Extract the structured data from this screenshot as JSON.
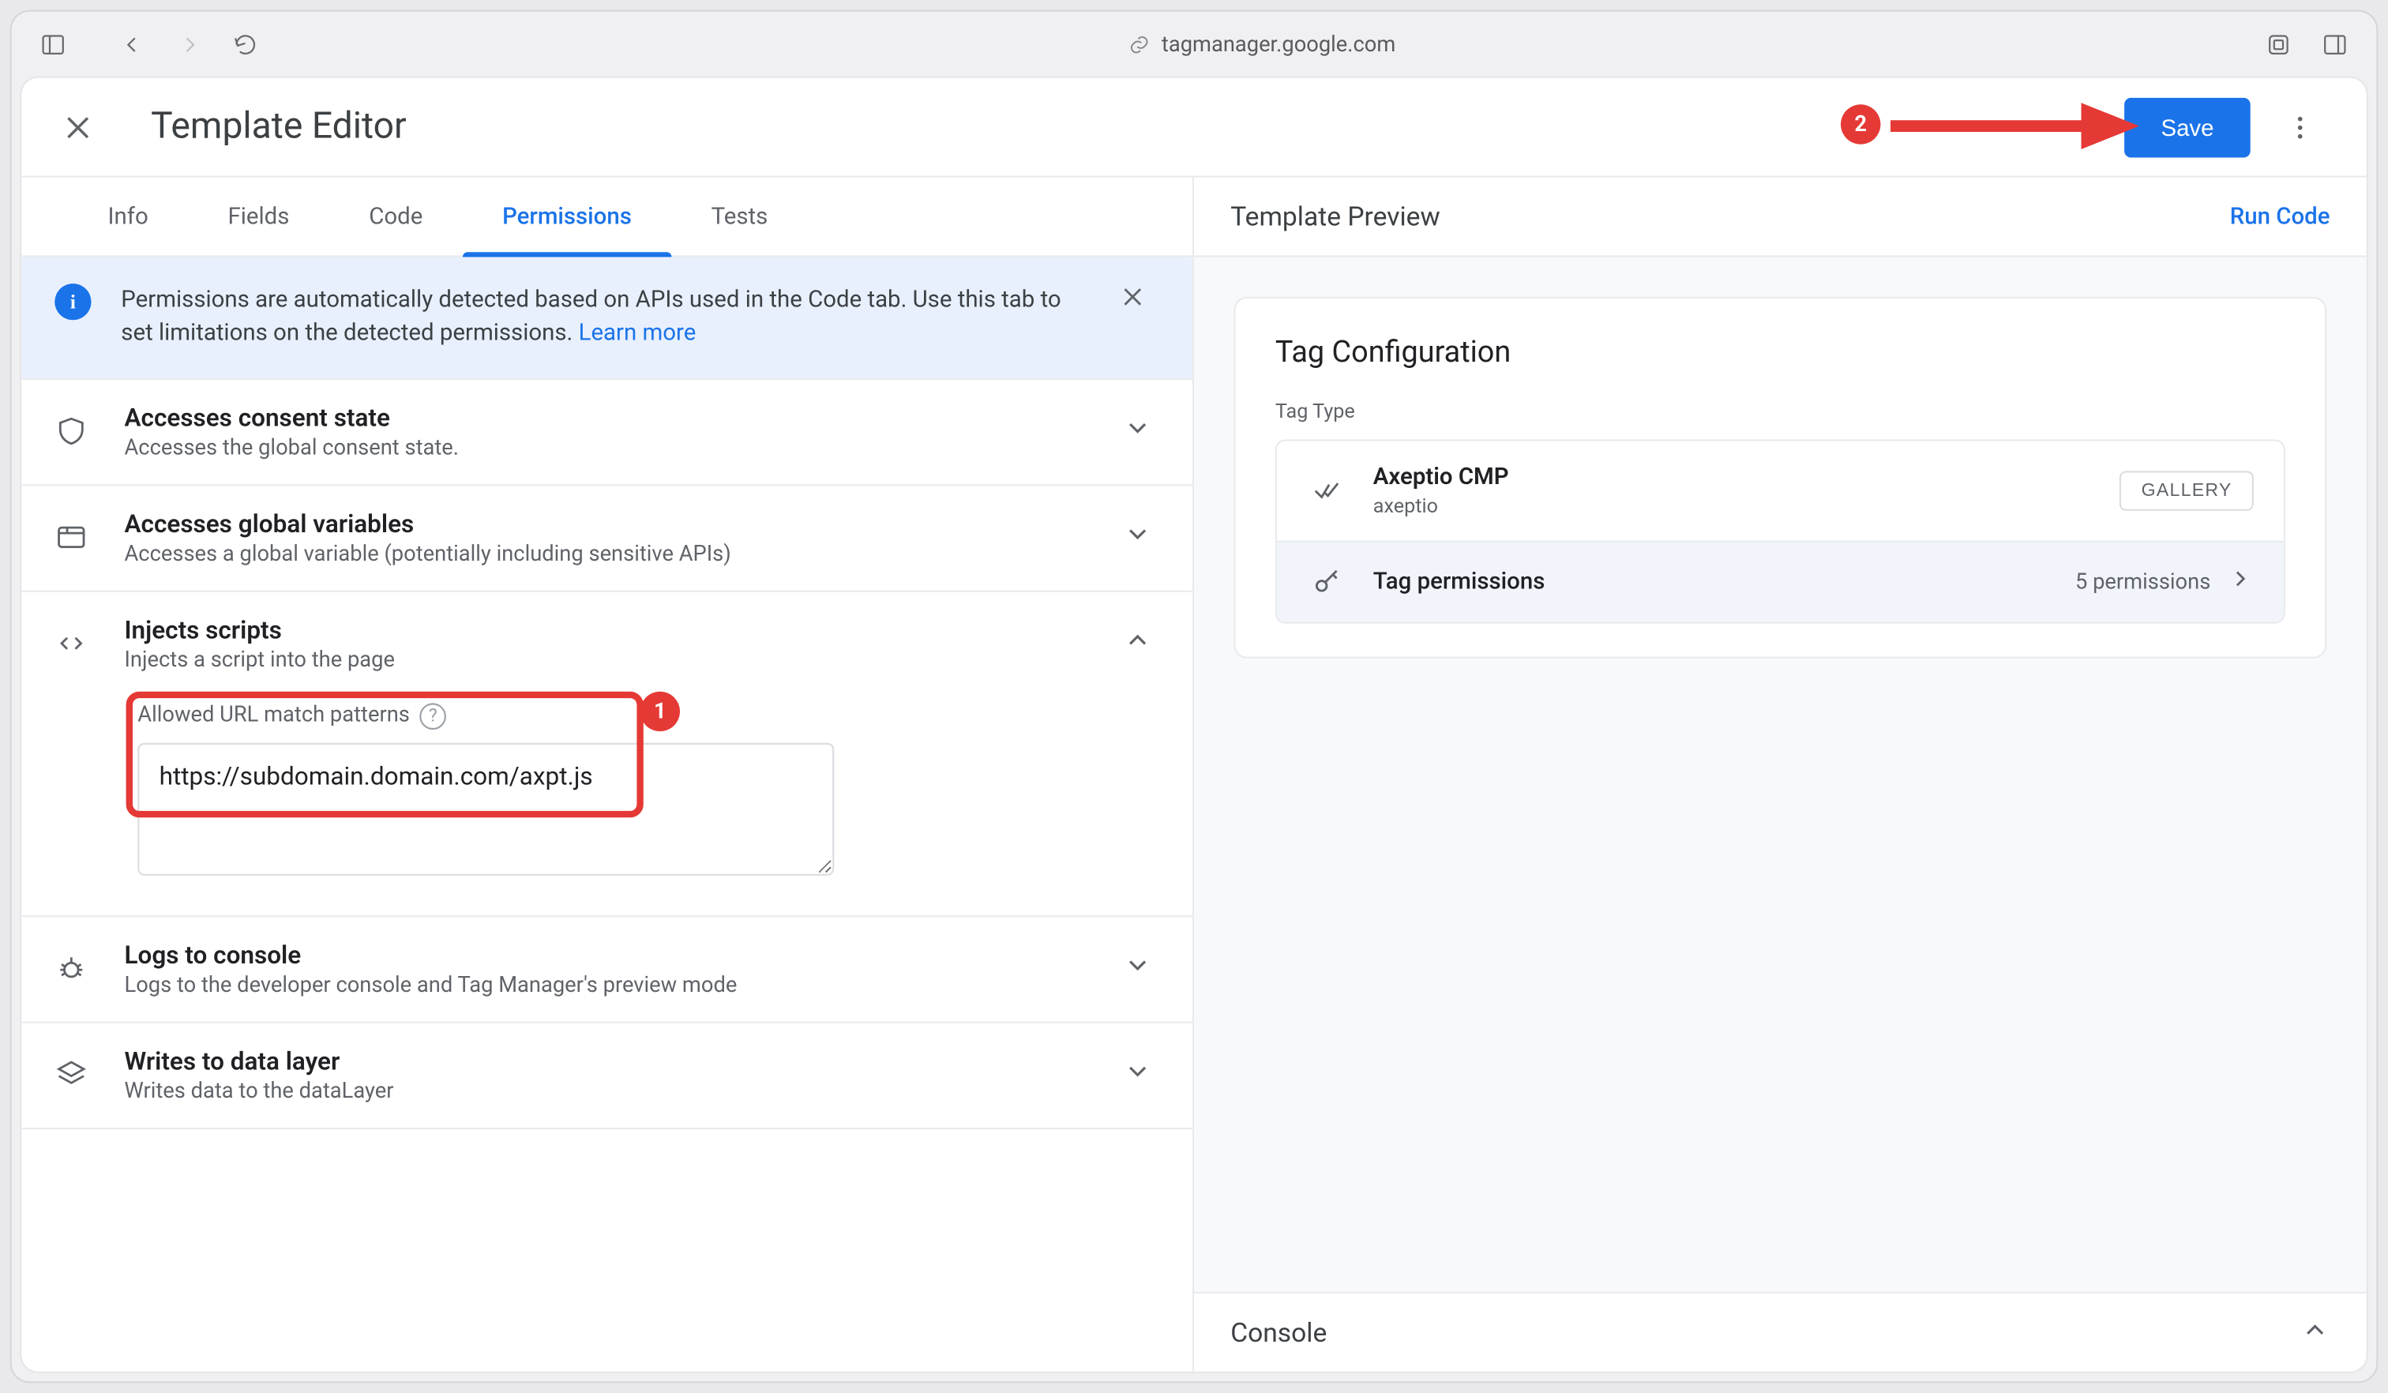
{
  "browser": {
    "url_host": "tagmanager.google.com"
  },
  "editor": {
    "title": "Template Editor",
    "save_label": "Save"
  },
  "tabs": [
    {
      "label": "Info"
    },
    {
      "label": "Fields"
    },
    {
      "label": "Code"
    },
    {
      "label": "Permissions"
    },
    {
      "label": "Tests"
    }
  ],
  "active_tab_index": 3,
  "banner": {
    "text_before": "Permissions are automatically detected based on APIs used in the Code tab. Use this tab to set limitations on the detected permissions. ",
    "learn_more": "Learn more"
  },
  "permissions": [
    {
      "title": "Accesses consent state",
      "desc": "Accesses the global consent state.",
      "expanded": false
    },
    {
      "title": "Accesses global variables",
      "desc": "Accesses a global variable (potentially including sensitive APIs)",
      "expanded": false
    },
    {
      "title": "Injects scripts",
      "desc": "Injects a script into the page",
      "expanded": true,
      "field_label": "Allowed URL match patterns",
      "field_value": "https://subdomain.domain.com/axpt.js"
    },
    {
      "title": "Logs to console",
      "desc": "Logs to the developer console and Tag Manager's preview mode",
      "expanded": false
    },
    {
      "title": "Writes to data layer",
      "desc": "Writes data to the dataLayer",
      "expanded": false
    }
  ],
  "preview": {
    "title": "Template Preview",
    "run_code": "Run Code",
    "card_title": "Tag Configuration",
    "tag_type_label": "Tag Type",
    "tag": {
      "name": "Axeptio CMP",
      "vendor": "axeptio",
      "gallery_label": "GALLERY"
    },
    "perm_row_label": "Tag permissions",
    "perm_count_text": "5 permissions"
  },
  "console": {
    "title": "Console"
  },
  "annotations": {
    "one": "1",
    "two": "2"
  }
}
